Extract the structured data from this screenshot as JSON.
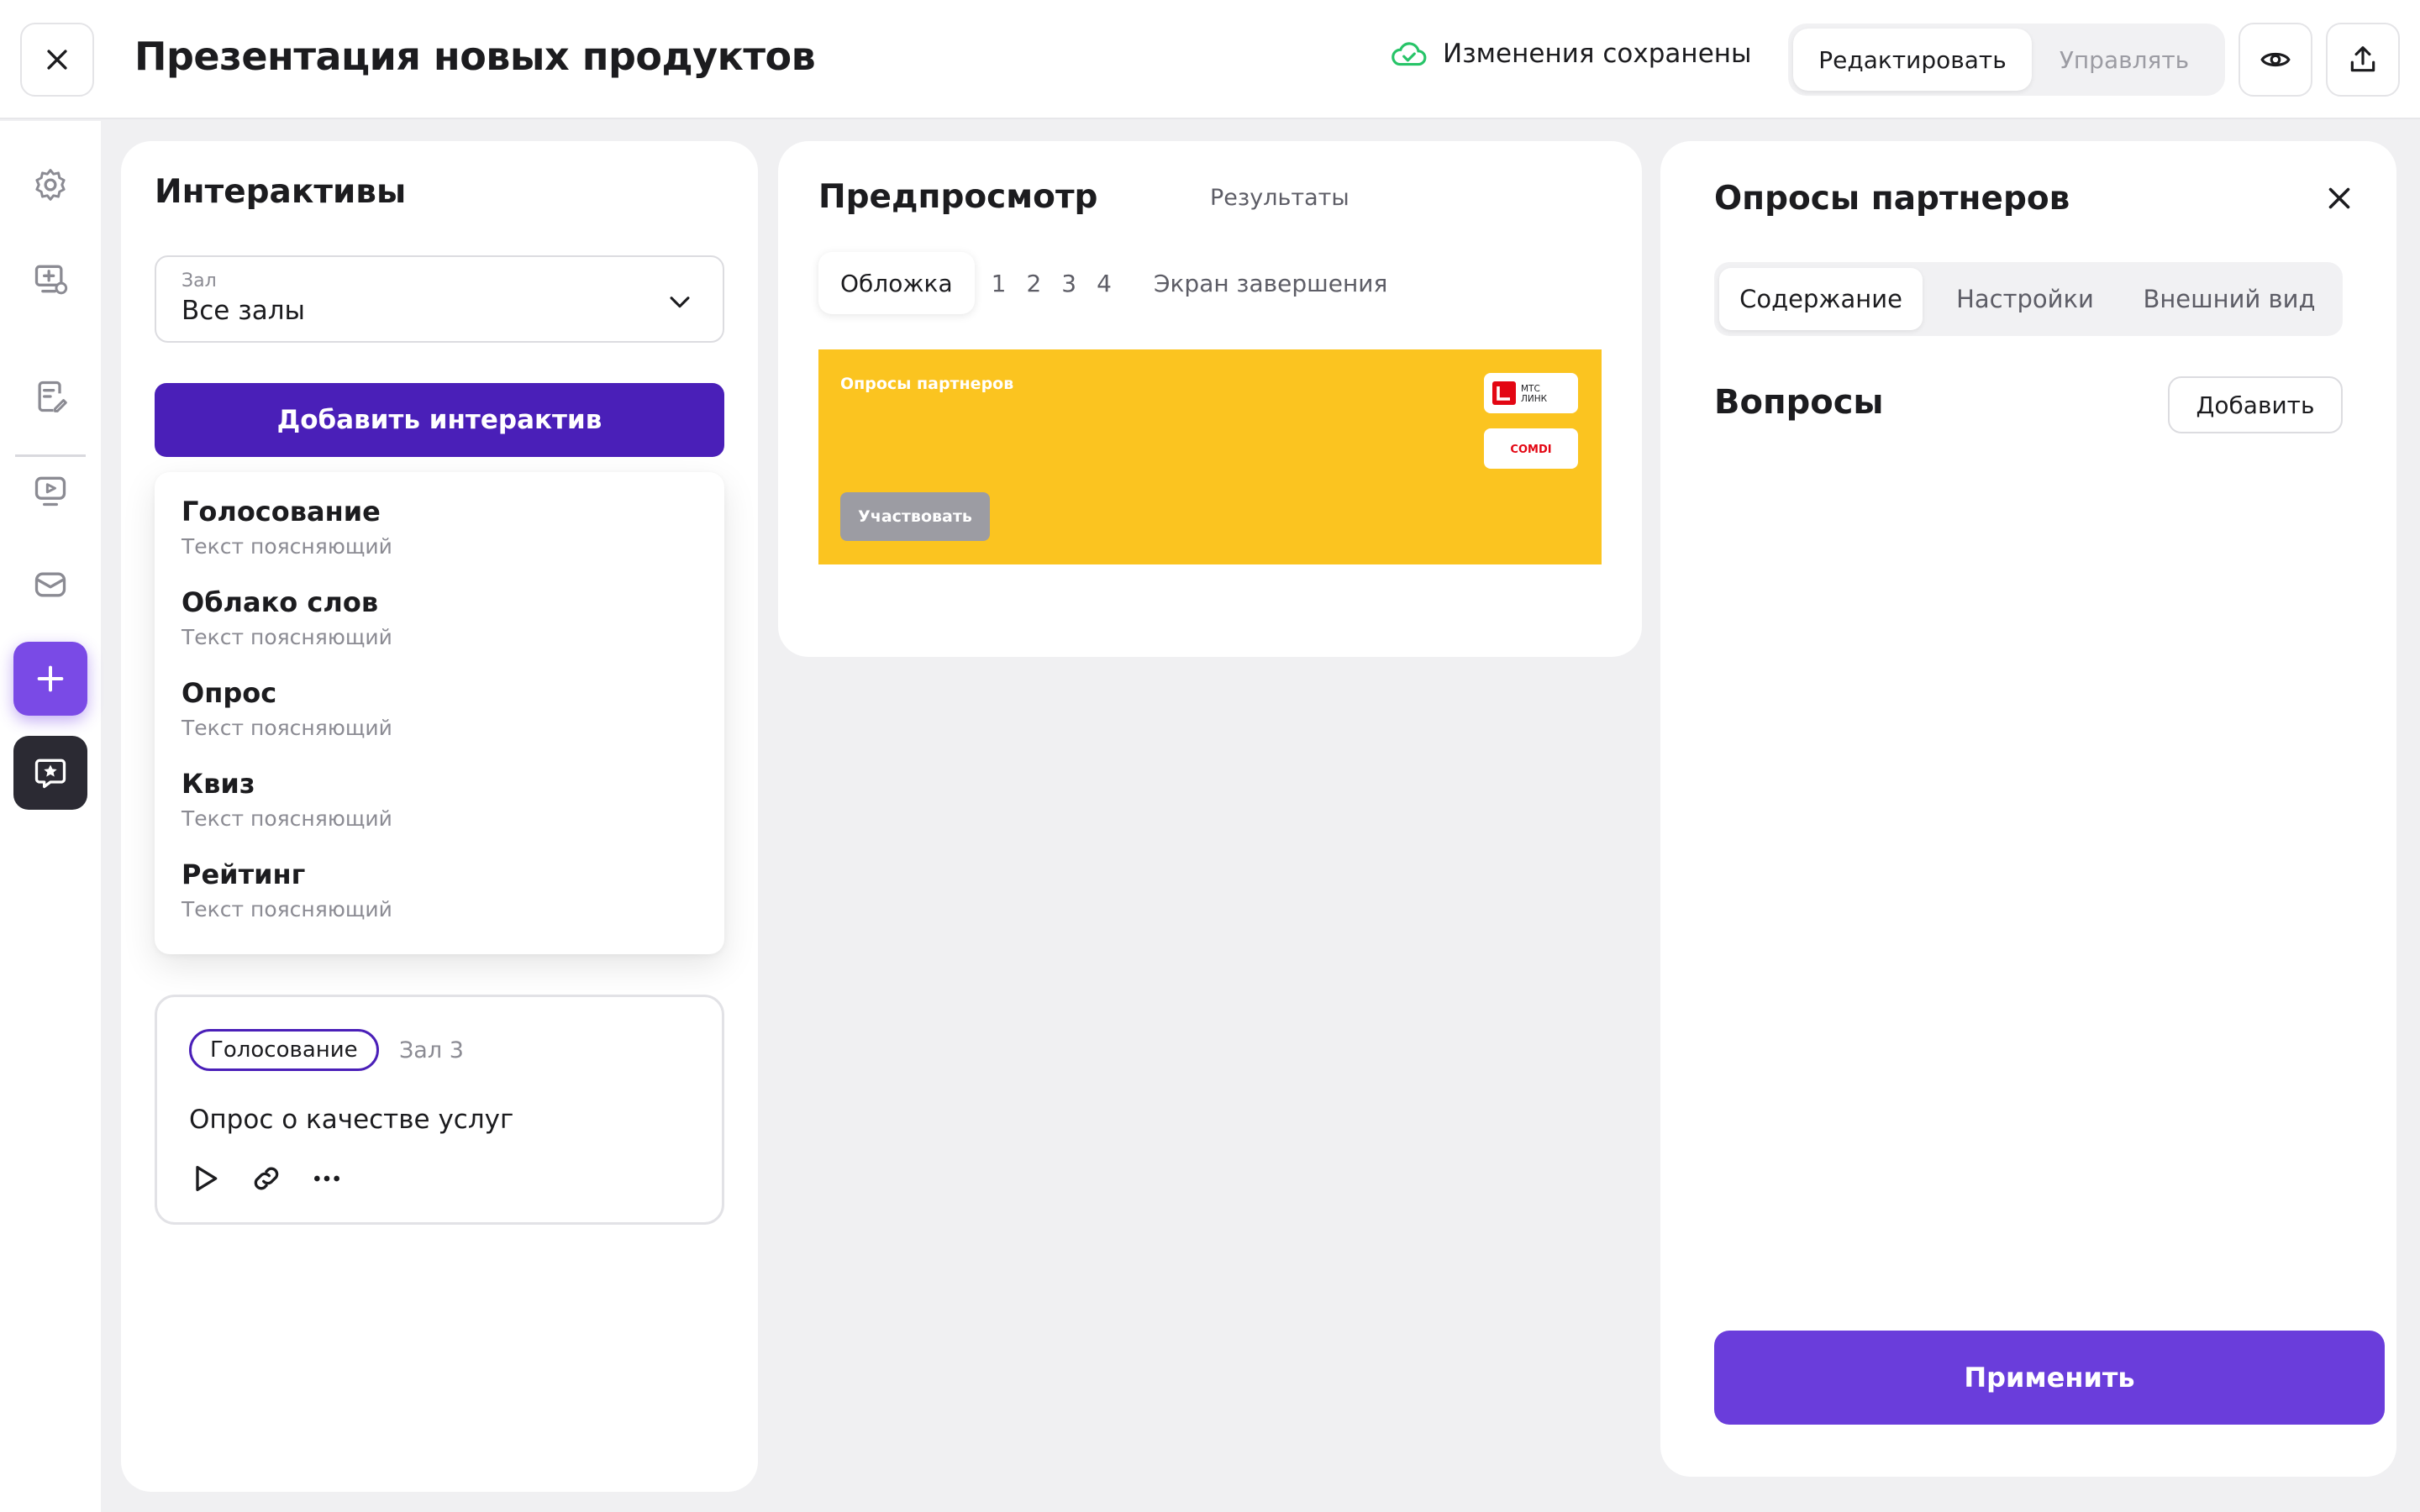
{
  "header": {
    "title": "Презентация новых продуктов",
    "save_status": "Изменения сохранены",
    "mode_tabs": [
      "Редактировать",
      "Управлять"
    ]
  },
  "interactives": {
    "title": "Интерактивы",
    "hall_label": "Зал",
    "hall_value": "Все залы",
    "add_button": "Добавить интерактив",
    "types": [
      {
        "title": "Голосование",
        "desc": "Текст поясняющий"
      },
      {
        "title": "Облако слов",
        "desc": "Текст поясняющий"
      },
      {
        "title": "Опрос",
        "desc": "Текст поясняющий"
      },
      {
        "title": "Квиз",
        "desc": "Текст поясняющий"
      },
      {
        "title": "Рейтинг",
        "desc": "Текст поясняющий"
      }
    ],
    "card": {
      "tag": "Голосование",
      "hall": "Зал 3",
      "title": "Опрос о качестве услуг"
    }
  },
  "preview": {
    "title": "Предпросмотр",
    "results_tab": "Результаты",
    "slide_tabs": {
      "cover": "Обложка",
      "numbers": [
        "1",
        "2",
        "3",
        "4"
      ],
      "finish": "Экран завершения"
    },
    "cover": {
      "title": "Опросы партнеров",
      "participate": "Участвовать",
      "logo1": "МТС ЛИНК",
      "logo2": "COMDI",
      "background": "#fbc420"
    }
  },
  "settings": {
    "title": "Опросы партнеров",
    "tabs": [
      "Содержание",
      "Настройки",
      "Внешний вид"
    ],
    "section": "Вопросы",
    "add": "Добавить",
    "apply": "Применить"
  },
  "colors": {
    "accent": "#4a1fb8",
    "apply": "#6a3ddb",
    "rail_active": "#7a4ae6",
    "rail_dark": "#2b2a33",
    "saved": "#27c468"
  },
  "icons": {
    "rail": [
      "gear-icon",
      "add-screen-icon",
      "edit-note-icon",
      "video-icon",
      "mail-icon",
      "plus-icon",
      "star-chat-icon"
    ],
    "card_actions": [
      "play-icon",
      "link-icon",
      "more-icon"
    ]
  }
}
